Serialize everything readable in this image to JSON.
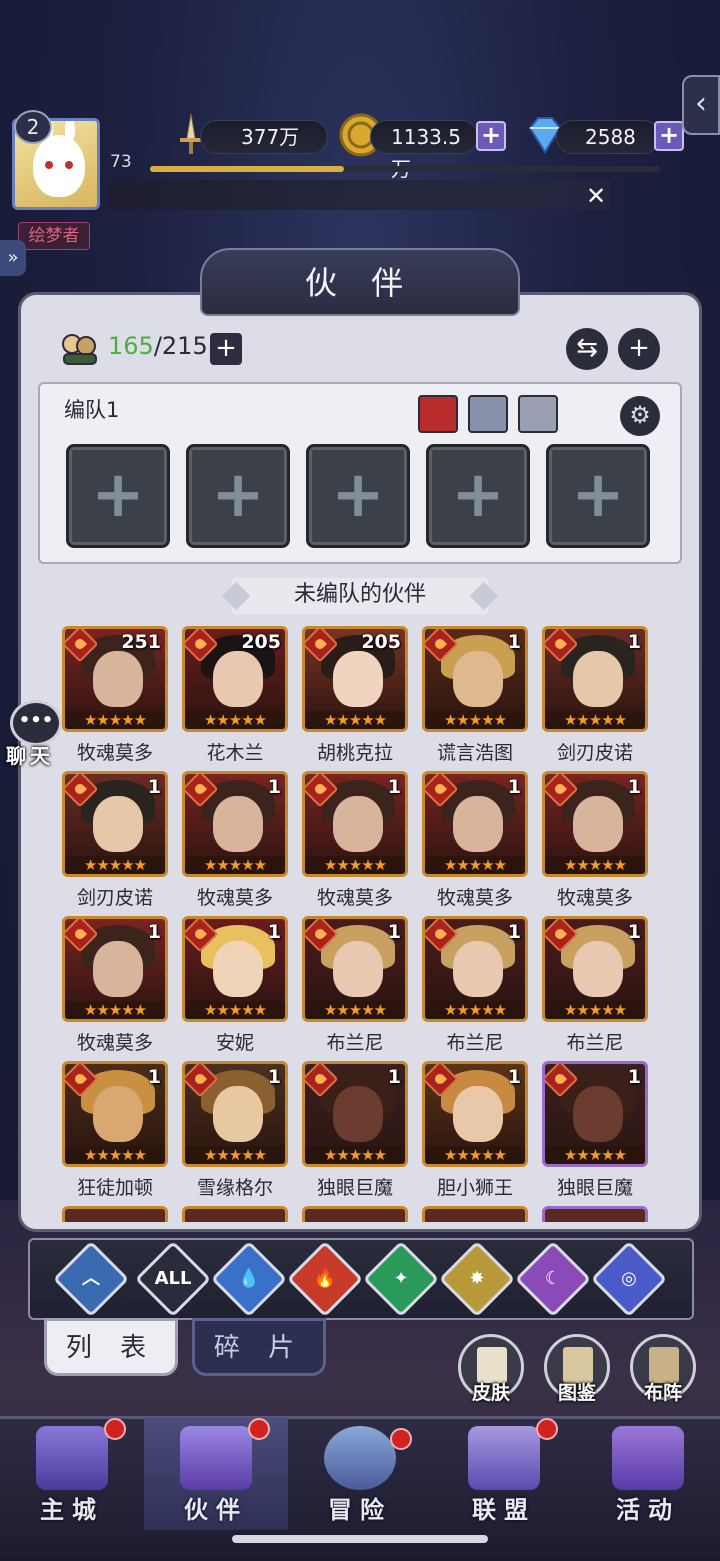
{
  "player": {
    "level": "2",
    "exp_level": "73",
    "exp_fraction": 0.38,
    "title": "绘梦者"
  },
  "resources": {
    "power": "377万",
    "gold": "1133.5万",
    "diamonds": "2588"
  },
  "panel": {
    "title": "伙 伴",
    "count_current": "165",
    "count_total": "/215"
  },
  "team": {
    "label": "编队1",
    "slot_symbol": "+"
  },
  "unassigned_header": "未编队的伙伴",
  "heroes": [
    {
      "name": "牧魂莫多",
      "level": "251",
      "face": "#d8b49a",
      "hair": "#3c241c",
      "bg": "#7a2420"
    },
    {
      "name": "花木兰",
      "level": "205",
      "face": "#eac8b0",
      "hair": "#1a1414",
      "bg": "#6a1c1c"
    },
    {
      "name": "胡桃克拉",
      "level": "205",
      "face": "#f0d4c0",
      "hair": "#2a1c18",
      "bg": "#7a3424"
    },
    {
      "name": "谎言浩图",
      "level": "1",
      "face": "#e0b890",
      "hair": "#c8a050",
      "bg": "#5a2a18"
    },
    {
      "name": "剑刃皮诺",
      "level": "1",
      "face": "#e6c8a8",
      "hair": "#2a2420",
      "bg": "#6a2c24"
    },
    {
      "name": "剑刃皮诺",
      "level": "1",
      "face": "#e6c8a8",
      "hair": "#2a2420",
      "bg": "#6a2c24"
    },
    {
      "name": "牧魂莫多",
      "level": "1",
      "face": "#d8b49a",
      "hair": "#3c241c",
      "bg": "#7a2420"
    },
    {
      "name": "牧魂莫多",
      "level": "1",
      "face": "#d8b49a",
      "hair": "#3c241c",
      "bg": "#7a2420"
    },
    {
      "name": "牧魂莫多",
      "level": "1",
      "face": "#d8b49a",
      "hair": "#3c241c",
      "bg": "#7a2420"
    },
    {
      "name": "牧魂莫多",
      "level": "1",
      "face": "#d8b49a",
      "hair": "#3c241c",
      "bg": "#7a2420"
    },
    {
      "name": "牧魂莫多",
      "level": "1",
      "face": "#d8b49a",
      "hair": "#3c241c",
      "bg": "#7a2420"
    },
    {
      "name": "安妮",
      "level": "1",
      "face": "#f0d4b8",
      "hair": "#e8c060",
      "bg": "#6a1c20"
    },
    {
      "name": "布兰尼",
      "level": "1",
      "face": "#e8c8b0",
      "hair": "#c8a060",
      "bg": "#4a1c1c"
    },
    {
      "name": "布兰尼",
      "level": "1",
      "face": "#e8c8b0",
      "hair": "#c8a060",
      "bg": "#4a1c1c"
    },
    {
      "name": "布兰尼",
      "level": "1",
      "face": "#e8c8b0",
      "hair": "#c8a060",
      "bg": "#4a1c1c"
    },
    {
      "name": "狂徒加顿",
      "level": "1",
      "face": "#d8a870",
      "hair": "#c89040",
      "bg": "#4a2c18"
    },
    {
      "name": "雪缘格尔",
      "level": "1",
      "face": "#e8c8a0",
      "hair": "#8a6030",
      "bg": "#4a3020"
    },
    {
      "name": "独眼巨魔",
      "level": "1",
      "face": "#6a3c30",
      "hair": "#3a2018",
      "bg": "#3a2020"
    },
    {
      "name": "胆小狮王",
      "level": "1",
      "face": "#e8c8a8",
      "hair": "#c88a40",
      "bg": "#5a3418"
    },
    {
      "name": "独眼巨魔",
      "level": "1",
      "face": "#6a3c30",
      "hair": "#3a2018",
      "bg": "#3a2020",
      "purple": true
    }
  ],
  "stars": "★★★★★",
  "chat_label": "聊天",
  "filters": [
    "ALL"
  ],
  "tabs": {
    "list": "列 表",
    "shards": "碎 片"
  },
  "tools": {
    "skin": "皮肤",
    "codex": "图鉴",
    "formation": "布阵"
  },
  "nav": {
    "city": "主城",
    "partner": "伙伴",
    "adventure": "冒险",
    "alliance": "联盟",
    "events": "活动"
  },
  "colors": {
    "accent_purple": "#6c5ab8",
    "star_orange": "#f39a28",
    "count_green": "#4cb040",
    "badge_red": "#d0221f",
    "frame_gold": "#c8882c"
  }
}
